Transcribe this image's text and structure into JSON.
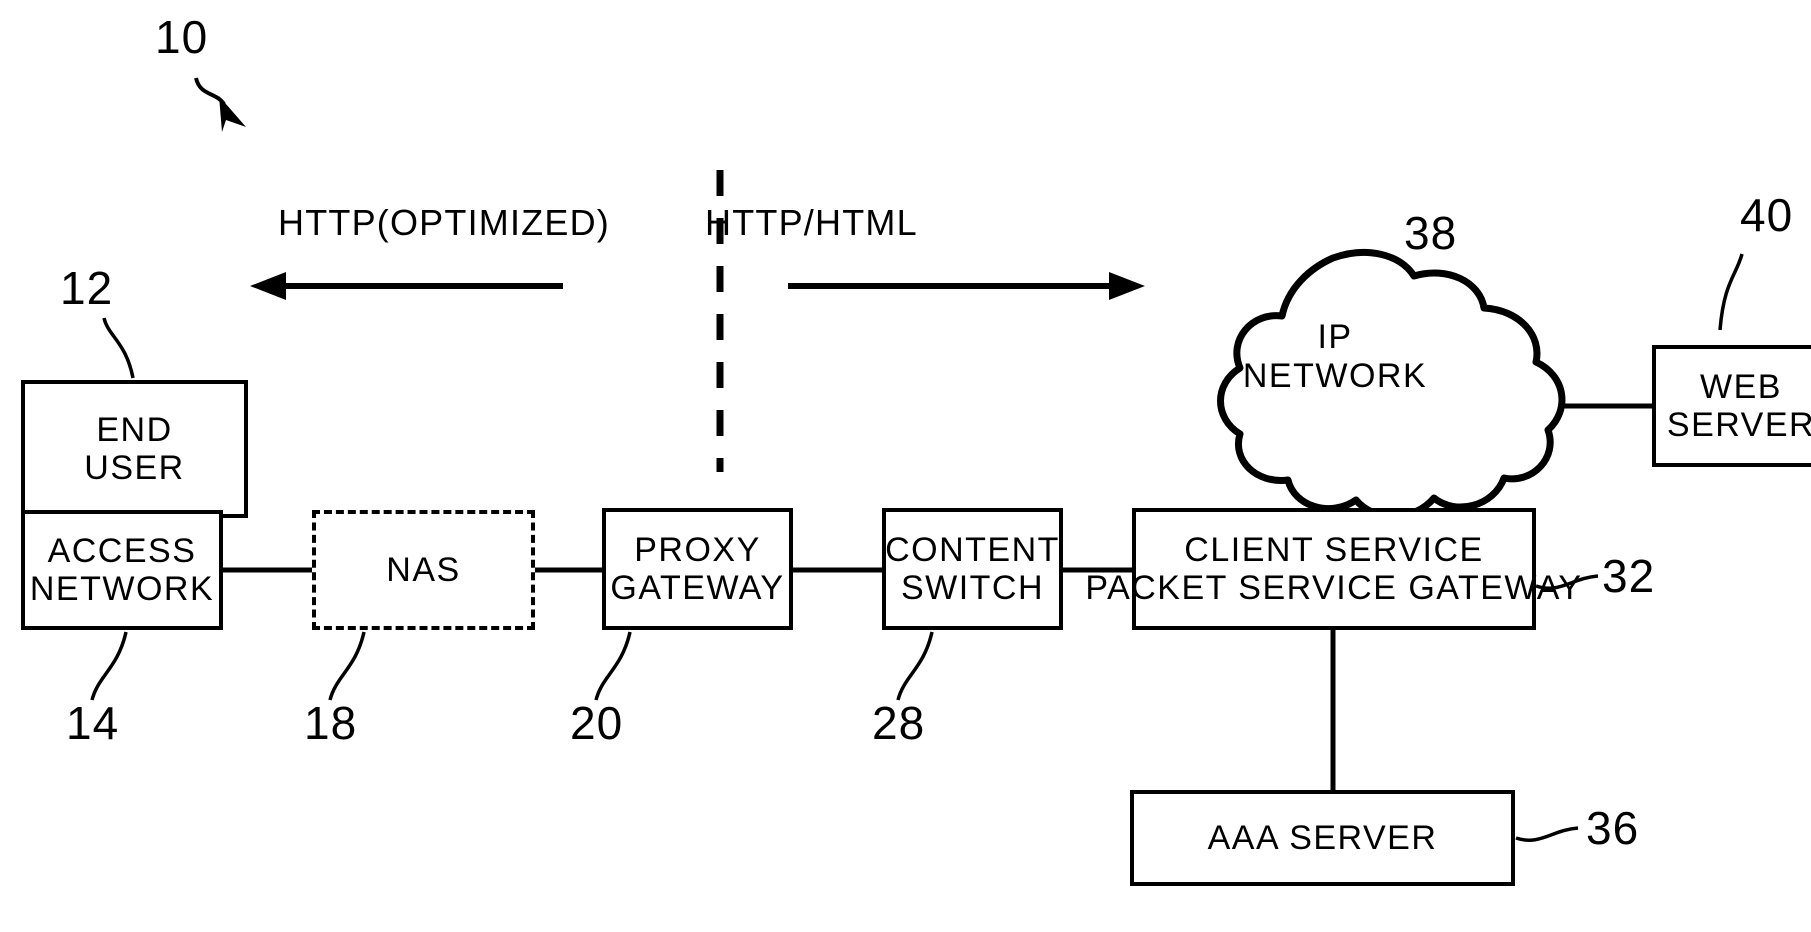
{
  "figure": {
    "figure_ref": "10",
    "divider": "dashed-vertical-line"
  },
  "flows": [
    {
      "id": "left-flow",
      "label": "HTTP(OPTIMIZED)",
      "direction": "left",
      "icon": "arrow-left-icon"
    },
    {
      "id": "right-flow",
      "label": "HTTP/HTML",
      "direction": "right",
      "icon": "arrow-right-icon"
    }
  ],
  "nodes": {
    "end_user": {
      "lines": [
        "END",
        "USER"
      ],
      "ref": "12",
      "style": "solid"
    },
    "access_network": {
      "lines": [
        "ACCESS",
        "NETWORK"
      ],
      "ref": "14",
      "style": "solid"
    },
    "nas": {
      "lines": [
        "NAS"
      ],
      "ref": "18",
      "style": "dashed"
    },
    "proxy_gateway": {
      "lines": [
        "PROXY",
        "GATEWAY"
      ],
      "ref": "20",
      "style": "solid"
    },
    "content_switch": {
      "lines": [
        "CONTENT",
        "SWITCH"
      ],
      "ref": "28",
      "style": "solid"
    },
    "client_service": {
      "lines": [
        "CLIENT  SERVICE",
        "PACKET  SERVICE  GATEWAY"
      ],
      "ref": "32",
      "style": "solid"
    },
    "ip_network": {
      "lines": [
        "IP",
        "NETWORK"
      ],
      "ref": "38",
      "style": "cloud"
    },
    "web_server": {
      "lines": [
        "WEB",
        "SERVER"
      ],
      "ref": "40",
      "style": "solid"
    },
    "aaa_server": {
      "lines": [
        "AAA  SERVER"
      ],
      "ref": "36",
      "style": "solid"
    }
  },
  "colors": {
    "ink": "#000000",
    "paper": "#ffffff"
  }
}
